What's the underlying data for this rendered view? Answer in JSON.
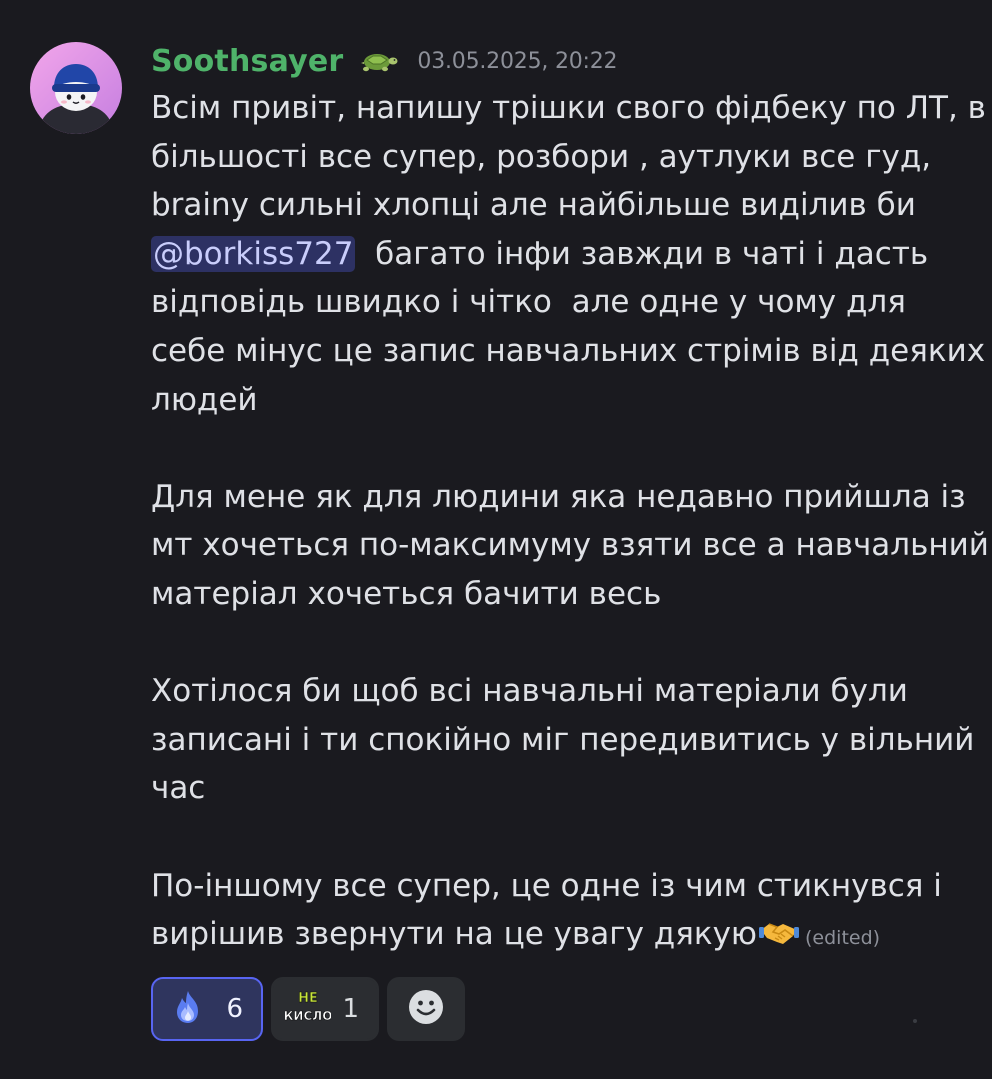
{
  "author": {
    "username": "Soothsayer",
    "role_icon": "turtle-icon",
    "timestamp": "03.05.2025, 20:22",
    "name_color": "#4fb36a"
  },
  "message": {
    "lines": [
      {
        "text": "Всім привіт, напишу трішки свого фідбеку по ЛТ, в"
      },
      {
        "text": "більшості все супер, розбори , аутлуки все гуд,"
      },
      {
        "text": "brainy сильні хлопці але найбільше виділив би"
      },
      {
        "mention": "@borkiss727",
        "after": "  багато інфи завжди в чаті і дасть"
      },
      {
        "text": "відповідь швидко і чітко  але одне у чому для"
      },
      {
        "text": "себе мінус це запис навчальних стрімів від деяких"
      },
      {
        "text": "людей"
      },
      {
        "text": ""
      },
      {
        "text": "Для мене як для людини яка недавно прийшла із"
      },
      {
        "text": "мт хочеться по-максимуму взяти все а навчальний"
      },
      {
        "text": "матеріал хочеться бачити весь"
      },
      {
        "text": ""
      },
      {
        "text": "Хотілося би щоб всі навчальні матеріали були"
      },
      {
        "text": "записані і ти спокійно міг передивитись у вільний"
      },
      {
        "text": "час"
      },
      {
        "text": ""
      },
      {
        "text": "По-іншому все супер, це одне із чим стикнувся і"
      },
      {
        "text": "вирішив звернути на це увагу дякую",
        "emoji": "handshake-icon",
        "edited": "(edited)"
      }
    ]
  },
  "reactions": [
    {
      "emoji": "blue-flame-icon",
      "count": "6",
      "active": true
    },
    {
      "emoji": "ne-kyslo-sticker-icon",
      "emoji_text_1": "НЕ",
      "emoji_text_2": "КИСЛО",
      "count": "1",
      "active": false
    }
  ],
  "add_reaction": {
    "icon": "smiley-face-icon"
  },
  "colors": {
    "background": "#1a1a1f",
    "mention_bg": "#3a3f78",
    "accent": "#5865f2"
  }
}
